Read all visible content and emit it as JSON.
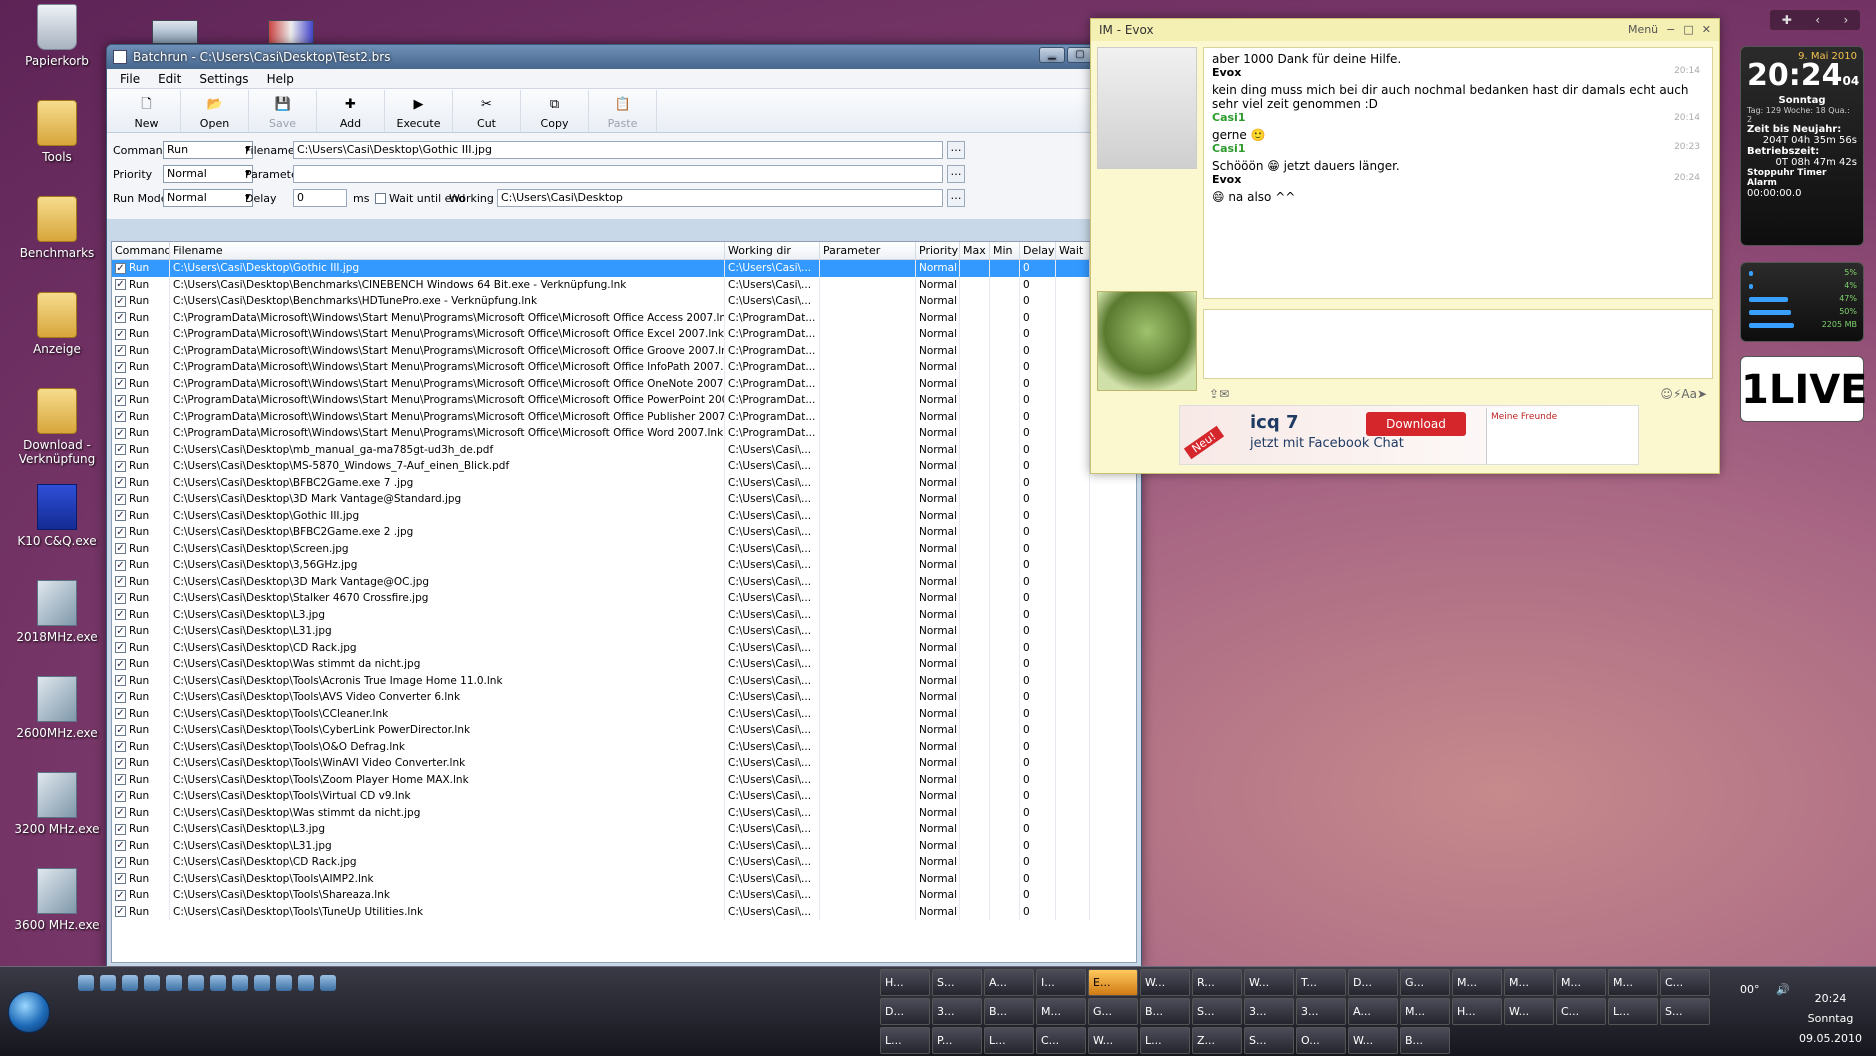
{
  "desktop": {
    "icons": [
      {
        "label": "Papierkorb",
        "icon": "recycle-bin-icon",
        "kind": "trash"
      },
      {
        "label": "Tools",
        "icon": "folder-icon",
        "kind": "folder"
      },
      {
        "label": "Benchmarks",
        "icon": "folder-icon",
        "kind": "folder"
      },
      {
        "label": "Anzeige",
        "icon": "folder-icon",
        "kind": "folder"
      },
      {
        "label": "Download - Verknüpfung",
        "icon": "folder-shortcut-icon",
        "kind": "folder"
      },
      {
        "label": "K10 C&Q.exe",
        "icon": "app-icon",
        "kind": "k10"
      },
      {
        "label": "2018MHz.exe",
        "icon": "exe-icon",
        "kind": "exe"
      },
      {
        "label": "2600MHz.exe",
        "icon": "exe-icon",
        "kind": "exe"
      },
      {
        "label": "3200 MHz.exe",
        "icon": "exe-icon",
        "kind": "exe"
      },
      {
        "label": "3600 MHz.exe",
        "icon": "exe-icon",
        "kind": "exe"
      }
    ]
  },
  "batchrun": {
    "title": "Batchrun - C:\\Users\\Casi\\Desktop\\Test2.brs",
    "menu": [
      "File",
      "Edit",
      "Settings",
      "Help"
    ],
    "toolbar": [
      {
        "label": "New",
        "icon": "new-file-icon",
        "glyph": "🗋",
        "enabled": true
      },
      {
        "label": "Open",
        "icon": "open-folder-icon",
        "glyph": "📂",
        "enabled": true
      },
      {
        "label": "Save",
        "icon": "save-icon",
        "glyph": "💾",
        "enabled": false
      },
      {
        "label": "Add",
        "icon": "add-icon",
        "glyph": "✚",
        "enabled": true
      },
      {
        "label": "Execute",
        "icon": "execute-icon",
        "glyph": "▶",
        "enabled": true
      },
      {
        "label": "Cut",
        "icon": "scissors-icon",
        "glyph": "✂",
        "enabled": true
      },
      {
        "label": "Copy",
        "icon": "copy-icon",
        "glyph": "⧉",
        "enabled": true
      },
      {
        "label": "Paste",
        "icon": "paste-icon",
        "glyph": "📋",
        "enabled": false
      }
    ],
    "fields": {
      "command_label": "Command",
      "command_value": "Run",
      "filename_label": "Filename",
      "filename_value": "C:\\Users\\Casi\\Desktop\\Gothic III.jpg",
      "priority_label": "Priority",
      "priority_value": "Normal",
      "parameter_label": "Parameter",
      "parameter_value": "",
      "runmode_label": "Run Mode",
      "runmode_value": "Normal",
      "delay_label": "Delay",
      "delay_value": "0",
      "delay_unit": "ms",
      "wait_label": "Wait until end",
      "workdir_label": "Working dir",
      "workdir_value": "C:\\Users\\Casi\\Desktop"
    },
    "columns": [
      "Command",
      "Filename",
      "Working dir",
      "Parameter",
      "Priority",
      "Max",
      "Min",
      "Delay",
      "Wait"
    ],
    "rows": [
      {
        "cmd": "Run",
        "file": "C:\\Users\\Casi\\Desktop\\Gothic III.jpg",
        "wd": "C:\\Users\\Casi\\...",
        "pri": "Normal",
        "delay": "0"
      },
      {
        "cmd": "Run",
        "file": "C:\\Users\\Casi\\Desktop\\Benchmarks\\CINEBENCH Windows 64 Bit.exe - Verknüpfung.lnk",
        "wd": "C:\\Users\\Casi\\...",
        "pri": "Normal",
        "delay": "0"
      },
      {
        "cmd": "Run",
        "file": "C:\\Users\\Casi\\Desktop\\Benchmarks\\HDTunePro.exe - Verknüpfung.lnk",
        "wd": "C:\\Users\\Casi\\...",
        "pri": "Normal",
        "delay": "0"
      },
      {
        "cmd": "Run",
        "file": "C:\\ProgramData\\Microsoft\\Windows\\Start Menu\\Programs\\Microsoft Office\\Microsoft Office Access 2007.lnk",
        "wd": "C:\\ProgramDat...",
        "pri": "Normal",
        "delay": "0"
      },
      {
        "cmd": "Run",
        "file": "C:\\ProgramData\\Microsoft\\Windows\\Start Menu\\Programs\\Microsoft Office\\Microsoft Office Excel 2007.lnk",
        "wd": "C:\\ProgramDat...",
        "pri": "Normal",
        "delay": "0"
      },
      {
        "cmd": "Run",
        "file": "C:\\ProgramData\\Microsoft\\Windows\\Start Menu\\Programs\\Microsoft Office\\Microsoft Office Groove 2007.lnk",
        "wd": "C:\\ProgramDat...",
        "pri": "Normal",
        "delay": "0"
      },
      {
        "cmd": "Run",
        "file": "C:\\ProgramData\\Microsoft\\Windows\\Start Menu\\Programs\\Microsoft Office\\Microsoft Office InfoPath 2007.lnk",
        "wd": "C:\\ProgramDat...",
        "pri": "Normal",
        "delay": "0"
      },
      {
        "cmd": "Run",
        "file": "C:\\ProgramData\\Microsoft\\Windows\\Start Menu\\Programs\\Microsoft Office\\Microsoft Office OneNote 2007.lnk",
        "wd": "C:\\ProgramDat...",
        "pri": "Normal",
        "delay": "0"
      },
      {
        "cmd": "Run",
        "file": "C:\\ProgramData\\Microsoft\\Windows\\Start Menu\\Programs\\Microsoft Office\\Microsoft Office PowerPoint 2007.lnk",
        "wd": "C:\\ProgramDat...",
        "pri": "Normal",
        "delay": "0"
      },
      {
        "cmd": "Run",
        "file": "C:\\ProgramData\\Microsoft\\Windows\\Start Menu\\Programs\\Microsoft Office\\Microsoft Office Publisher 2007.lnk",
        "wd": "C:\\ProgramDat...",
        "pri": "Normal",
        "delay": "0"
      },
      {
        "cmd": "Run",
        "file": "C:\\ProgramData\\Microsoft\\Windows\\Start Menu\\Programs\\Microsoft Office\\Microsoft Office Word 2007.lnk",
        "wd": "C:\\ProgramDat...",
        "pri": "Normal",
        "delay": "0"
      },
      {
        "cmd": "Run",
        "file": "C:\\Users\\Casi\\Desktop\\mb_manual_ga-ma785gt-ud3h_de.pdf",
        "wd": "C:\\Users\\Casi\\...",
        "pri": "Normal",
        "delay": "0"
      },
      {
        "cmd": "Run",
        "file": "C:\\Users\\Casi\\Desktop\\MS-5870_Windows_7-Auf_einen_Blick.pdf",
        "wd": "C:\\Users\\Casi\\...",
        "pri": "Normal",
        "delay": "0"
      },
      {
        "cmd": "Run",
        "file": "C:\\Users\\Casi\\Desktop\\BFBC2Game.exe 7 .jpg",
        "wd": "C:\\Users\\Casi\\...",
        "pri": "Normal",
        "delay": "0"
      },
      {
        "cmd": "Run",
        "file": "C:\\Users\\Casi\\Desktop\\3D Mark Vantage@Standard.jpg",
        "wd": "C:\\Users\\Casi\\...",
        "pri": "Normal",
        "delay": "0"
      },
      {
        "cmd": "Run",
        "file": "C:\\Users\\Casi\\Desktop\\Gothic III.jpg",
        "wd": "C:\\Users\\Casi\\...",
        "pri": "Normal",
        "delay": "0"
      },
      {
        "cmd": "Run",
        "file": "C:\\Users\\Casi\\Desktop\\BFBC2Game.exe 2 .jpg",
        "wd": "C:\\Users\\Casi\\...",
        "pri": "Normal",
        "delay": "0"
      },
      {
        "cmd": "Run",
        "file": "C:\\Users\\Casi\\Desktop\\Screen.jpg",
        "wd": "C:\\Users\\Casi\\...",
        "pri": "Normal",
        "delay": "0"
      },
      {
        "cmd": "Run",
        "file": "C:\\Users\\Casi\\Desktop\\3,56GHz.jpg",
        "wd": "C:\\Users\\Casi\\...",
        "pri": "Normal",
        "delay": "0"
      },
      {
        "cmd": "Run",
        "file": "C:\\Users\\Casi\\Desktop\\3D Mark Vantage@OC.jpg",
        "wd": "C:\\Users\\Casi\\...",
        "pri": "Normal",
        "delay": "0"
      },
      {
        "cmd": "Run",
        "file": "C:\\Users\\Casi\\Desktop\\Stalker 4670 Crossfire.jpg",
        "wd": "C:\\Users\\Casi\\...",
        "pri": "Normal",
        "delay": "0"
      },
      {
        "cmd": "Run",
        "file": "C:\\Users\\Casi\\Desktop\\L3.jpg",
        "wd": "C:\\Users\\Casi\\...",
        "pri": "Normal",
        "delay": "0"
      },
      {
        "cmd": "Run",
        "file": "C:\\Users\\Casi\\Desktop\\L31.jpg",
        "wd": "C:\\Users\\Casi\\...",
        "pri": "Normal",
        "delay": "0"
      },
      {
        "cmd": "Run",
        "file": "C:\\Users\\Casi\\Desktop\\CD Rack.jpg",
        "wd": "C:\\Users\\Casi\\...",
        "pri": "Normal",
        "delay": "0"
      },
      {
        "cmd": "Run",
        "file": "C:\\Users\\Casi\\Desktop\\Was stimmt da nicht.jpg",
        "wd": "C:\\Users\\Casi\\...",
        "pri": "Normal",
        "delay": "0"
      },
      {
        "cmd": "Run",
        "file": "C:\\Users\\Casi\\Desktop\\Tools\\Acronis True Image Home 11.0.lnk",
        "wd": "C:\\Users\\Casi\\...",
        "pri": "Normal",
        "delay": "0"
      },
      {
        "cmd": "Run",
        "file": "C:\\Users\\Casi\\Desktop\\Tools\\AVS Video Converter 6.lnk",
        "wd": "C:\\Users\\Casi\\...",
        "pri": "Normal",
        "delay": "0"
      },
      {
        "cmd": "Run",
        "file": "C:\\Users\\Casi\\Desktop\\Tools\\CCleaner.lnk",
        "wd": "C:\\Users\\Casi\\...",
        "pri": "Normal",
        "delay": "0"
      },
      {
        "cmd": "Run",
        "file": "C:\\Users\\Casi\\Desktop\\Tools\\CyberLink PowerDirector.lnk",
        "wd": "C:\\Users\\Casi\\...",
        "pri": "Normal",
        "delay": "0"
      },
      {
        "cmd": "Run",
        "file": "C:\\Users\\Casi\\Desktop\\Tools\\O&O Defrag.lnk",
        "wd": "C:\\Users\\Casi\\...",
        "pri": "Normal",
        "delay": "0"
      },
      {
        "cmd": "Run",
        "file": "C:\\Users\\Casi\\Desktop\\Tools\\WinAVI Video Converter.lnk",
        "wd": "C:\\Users\\Casi\\...",
        "pri": "Normal",
        "delay": "0"
      },
      {
        "cmd": "Run",
        "file": "C:\\Users\\Casi\\Desktop\\Tools\\Zoom Player Home MAX.lnk",
        "wd": "C:\\Users\\Casi\\...",
        "pri": "Normal",
        "delay": "0"
      },
      {
        "cmd": "Run",
        "file": "C:\\Users\\Casi\\Desktop\\Tools\\Virtual CD v9.lnk",
        "wd": "C:\\Users\\Casi\\...",
        "pri": "Normal",
        "delay": "0"
      },
      {
        "cmd": "Run",
        "file": "C:\\Users\\Casi\\Desktop\\Was stimmt da nicht.jpg",
        "wd": "C:\\Users\\Casi\\...",
        "pri": "Normal",
        "delay": "0"
      },
      {
        "cmd": "Run",
        "file": "C:\\Users\\Casi\\Desktop\\L3.jpg",
        "wd": "C:\\Users\\Casi\\...",
        "pri": "Normal",
        "delay": "0"
      },
      {
        "cmd": "Run",
        "file": "C:\\Users\\Casi\\Desktop\\L31.jpg",
        "wd": "C:\\Users\\Casi\\...",
        "pri": "Normal",
        "delay": "0"
      },
      {
        "cmd": "Run",
        "file": "C:\\Users\\Casi\\Desktop\\CD Rack.jpg",
        "wd": "C:\\Users\\Casi\\...",
        "pri": "Normal",
        "delay": "0"
      },
      {
        "cmd": "Run",
        "file": "C:\\Users\\Casi\\Desktop\\Tools\\AIMP2.lnk",
        "wd": "C:\\Users\\Casi\\...",
        "pri": "Normal",
        "delay": "0"
      },
      {
        "cmd": "Run",
        "file": "C:\\Users\\Casi\\Desktop\\Tools\\Shareaza.lnk",
        "wd": "C:\\Users\\Casi\\...",
        "pri": "Normal",
        "delay": "0"
      },
      {
        "cmd": "Run",
        "file": "C:\\Users\\Casi\\Desktop\\Tools\\TuneUp Utilities.lnk",
        "wd": "C:\\Users\\Casi\\...",
        "pri": "Normal",
        "delay": "0"
      }
    ]
  },
  "im": {
    "title": "IM - Evox",
    "menu_label": "Menü",
    "messages": [
      {
        "text": "aber 1000 Dank für deine Hilfe.",
        "who": "Evox",
        "time": "20:14",
        "kind": "evox"
      },
      {
        "text": "kein ding muss mich bei dir auch nochmal bedanken hast dir damals echt auch sehr viel zeit genommen :D",
        "who": "Casi1",
        "time": "20:14",
        "kind": "casi"
      },
      {
        "text": "gerne 🙂",
        "who": "Casi1",
        "time": "20:23",
        "kind": "casi"
      },
      {
        "text": "Schööön 😁 jetzt dauers länger.",
        "who": "Evox",
        "time": "20:24",
        "kind": "evox"
      },
      {
        "text": "😄 na also ^^",
        "who": "",
        "time": "",
        "kind": "evox"
      }
    ],
    "ad": {
      "brand": "icq 7",
      "tagline": "jetzt mit Facebook Chat",
      "download": "Download",
      "badge": "Neu!",
      "friends_title": "Meine Freunde"
    }
  },
  "gadgets": {
    "clock_date": "9. Mai 2010",
    "clock_time": "20:24",
    "clock_seconds": "04",
    "clock_day": "Sonntag",
    "clock_info": "Tag: 129 Woche: 18 Qua.: 2",
    "newyear_label": "Zeit bis Neujahr:",
    "newyear_value": "204T 04h 35m 56s",
    "uptime_label": "Betriebszeit:",
    "uptime_value": "0T 08h 47m 42s",
    "tabs": "Stoppuhr Timer Alarm",
    "stopwatch": "00:00:00.0",
    "meter": [
      {
        "label": "5%",
        "level": 0.05
      },
      {
        "label": "4%",
        "level": 0.04
      },
      {
        "label": "47%",
        "level": 0.47
      },
      {
        "label": "50%",
        "level": 0.5
      },
      {
        "label": "2205 MB",
        "level": 0.54
      }
    ],
    "radio_logo": "1LIVE"
  },
  "taskbar": {
    "tasks": [
      "H...",
      "S...",
      "A...",
      "I...",
      "E...",
      "W...",
      "R...",
      "W...",
      "T...",
      "D...",
      "G...",
      "M...",
      "M...",
      "M...",
      "M...",
      "C...",
      "D...",
      "3...",
      "B...",
      "M...",
      "G...",
      "B...",
      "S...",
      "3...",
      "3...",
      "A...",
      "M...",
      "H...",
      "W...",
      "C...",
      "L...",
      "S...",
      "L...",
      "P...",
      "L...",
      "C...",
      "W...",
      "L...",
      "Z...",
      "S...",
      "O...",
      "W...",
      "B..."
    ],
    "active_index": 4,
    "clock_time": "20:24",
    "clock_day": "Sonntag",
    "clock_date": "09.05.2010",
    "tray_temp": "00°"
  }
}
